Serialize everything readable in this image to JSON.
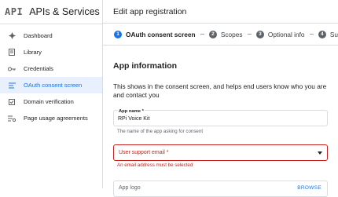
{
  "sidebar": {
    "logo": "API",
    "title": "APIs & Services",
    "items": [
      {
        "label": "Dashboard",
        "icon": "dashboard-icon"
      },
      {
        "label": "Library",
        "icon": "library-icon"
      },
      {
        "label": "Credentials",
        "icon": "key-icon"
      },
      {
        "label": "OAuth consent screen",
        "icon": "consent-icon",
        "active": true
      },
      {
        "label": "Domain verification",
        "icon": "checkbox-icon"
      },
      {
        "label": "Page usage agreements",
        "icon": "settings-list-icon"
      }
    ]
  },
  "header": {
    "title": "Edit app registration"
  },
  "stepper": {
    "steps": [
      {
        "num": "1",
        "label": "OAuth consent screen",
        "active": true
      },
      {
        "num": "2",
        "label": "Scopes"
      },
      {
        "num": "3",
        "label": "Optional info"
      },
      {
        "num": "4",
        "label": "Su"
      }
    ]
  },
  "form": {
    "section_title": "App information",
    "description": "This shows in the consent screen, and helps end users know who you are and contact you",
    "app_name": {
      "label": "App name *",
      "value": "RPi Voice Kit",
      "hint": "The name of the app asking for consent"
    },
    "support_email": {
      "placeholder": "User support email *",
      "error": "An email address must be selected"
    },
    "app_logo": {
      "placeholder": "App logo",
      "browse": "BROWSE"
    }
  },
  "colors": {
    "accent": "#1a73e8",
    "error": "#c5221f",
    "active_bg": "#e8f0fe"
  }
}
